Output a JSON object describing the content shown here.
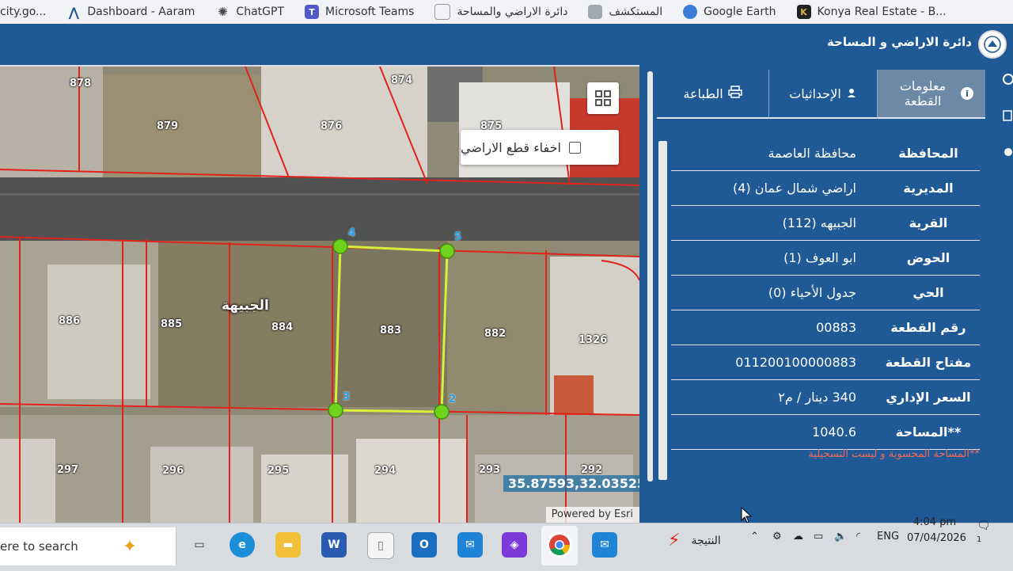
{
  "bookmarks": [
    {
      "label": "city.go...",
      "icon": "city-icon"
    },
    {
      "label": "Dashboard - Aaram",
      "icon": "aaram-icon"
    },
    {
      "label": "ChatGPT",
      "icon": "chatgpt-icon"
    },
    {
      "label": "Microsoft Teams",
      "icon": "teams-icon"
    },
    {
      "label": "دائرة الاراضي والمساحة",
      "icon": "dls-icon"
    },
    {
      "label": "المستكشف",
      "icon": "explorer-icon"
    },
    {
      "label": "Google Earth",
      "icon": "earth-icon"
    },
    {
      "label": "Konya Real Estate - B...",
      "icon": "konya-icon"
    }
  ],
  "app": {
    "title": "دائرة الاراضي و المساحة"
  },
  "map": {
    "hide_parcels_label": "اخفاء قطع الاراضي",
    "coordinates": "35.87593,32.03525",
    "powered_by": "Powered by Esri",
    "area_label": "الجبيهة",
    "parcel_labels": [
      "878",
      "874",
      "879",
      "876",
      "875",
      "886",
      "885",
      "884",
      "883",
      "882",
      "1326",
      "297",
      "296",
      "295",
      "294",
      "293",
      "292"
    ],
    "vertex_labels": [
      "4",
      "5",
      "3",
      "2"
    ],
    "colors": {
      "parcel_border": "#e0221b",
      "selected_outline": "#d8f03a",
      "vertex": "#6fd21c"
    }
  },
  "panel": {
    "tabs": [
      {
        "label": "معلومات القطعة",
        "icon": "info-icon"
      },
      {
        "label": "الإحداثيات",
        "icon": "location-icon"
      },
      {
        "label": "الطباعة",
        "icon": "printer-icon"
      }
    ],
    "rows": [
      {
        "label": "المحافظة",
        "value": "محافظة العاصمة"
      },
      {
        "label": "المديرية",
        "value": "اراضي شمال عمان (4)"
      },
      {
        "label": "القرية",
        "value": "الجبيهه (112)"
      },
      {
        "label": "الحوض",
        "value": "ابو العوف (1)"
      },
      {
        "label": "الحي",
        "value": "جدول الأحياء (0)"
      },
      {
        "label": "رقم القطعة",
        "value": "00883"
      },
      {
        "label": "مفتاح القطعة",
        "value": "011200100000883"
      },
      {
        "label": "السعر الإداري",
        "value": "340 دينار / م٢"
      },
      {
        "label": "**المساحة",
        "value": "1040.6"
      }
    ],
    "note": "**المساحة المحسوبة و ليست التسجيلية"
  },
  "taskbar": {
    "search": "ere to search",
    "news_label": "النتيجة",
    "lang": "ENG",
    "time": "4:04 pm",
    "date": "07/04/2026",
    "notifications": "1"
  }
}
